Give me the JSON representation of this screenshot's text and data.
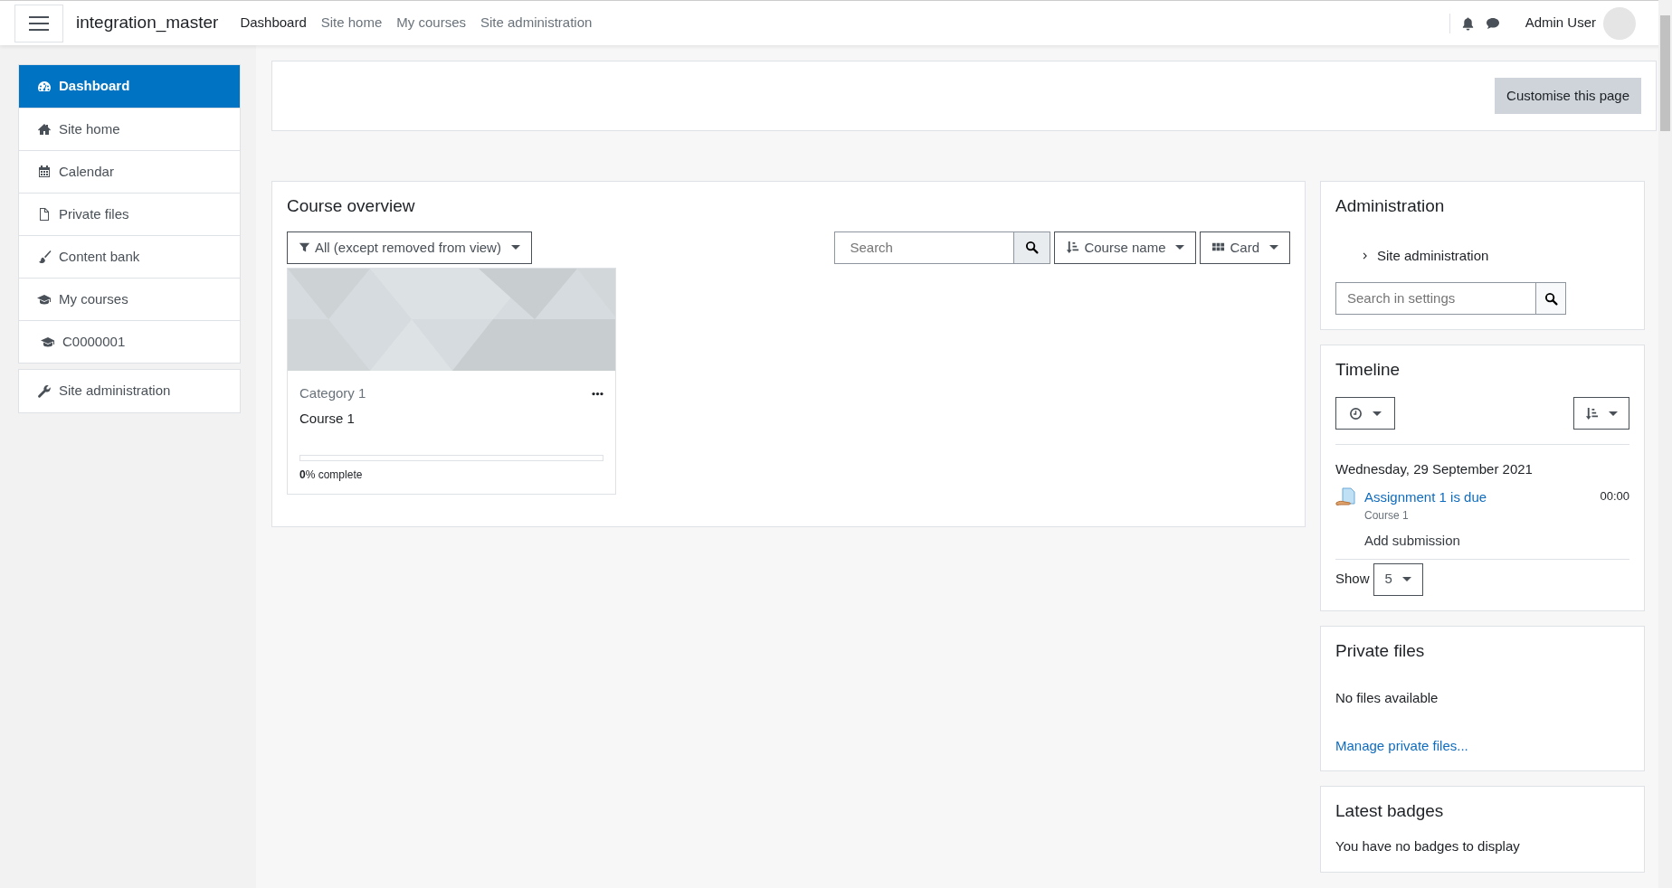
{
  "navbar": {
    "brand": "integration_master",
    "links": [
      {
        "label": "Dashboard",
        "selected": true
      },
      {
        "label": "Site home",
        "selected": false
      },
      {
        "label": "My courses",
        "selected": false
      },
      {
        "label": "Site administration",
        "selected": false
      }
    ],
    "user_name": "Admin User"
  },
  "sidebar": {
    "items": [
      {
        "label": "Dashboard",
        "selected": true
      },
      {
        "label": "Site home",
        "selected": false
      },
      {
        "label": "Calendar",
        "selected": false
      },
      {
        "label": "Private files",
        "selected": false
      },
      {
        "label": "Content bank",
        "selected": false
      },
      {
        "label": "My courses",
        "selected": false,
        "children": [
          {
            "label": "C0000001",
            "selected": false
          }
        ]
      }
    ],
    "admin_items": [
      {
        "label": "Site administration",
        "selected": false
      }
    ]
  },
  "customise_button": "Customise this page",
  "course_overview": {
    "title": "Course overview",
    "filter": "All (except removed from view)",
    "search_placeholder": "Search",
    "sort": "Course name",
    "view": "Card",
    "courses": [
      {
        "category": "Category 1",
        "name": "Course 1",
        "level": 0,
        "progress_text": "**0**% complete"
      }
    ]
  },
  "administration": {
    "title": "Administration",
    "items": [
      {
        "label": "Site administration",
        "expanded": false
      }
    ],
    "search_placeholder": "Search in settings"
  },
  "timeline": {
    "title": "Timeline",
    "date": "Wednesday, 29 September 2021",
    "events": [
      {
        "title": "Assignment 1 is due",
        "course": "Course 1",
        "action": "Add submission",
        "time": "00:00"
      }
    ],
    "show_label": "Show",
    "show_value": "5"
  },
  "private_files": {
    "title": "Private files",
    "message": "No files available",
    "link": "Manage private files..."
  },
  "badges": {
    "title": "Latest badges",
    "message": "You have no badges to display"
  }
}
